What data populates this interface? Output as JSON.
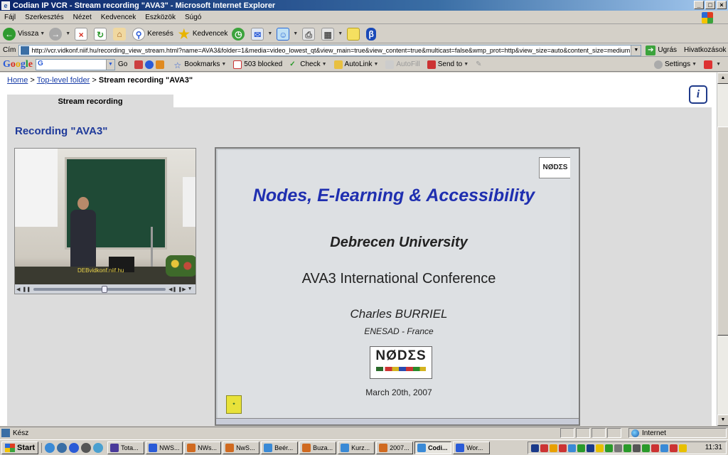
{
  "window": {
    "title": "Codian IP VCR - Stream recording \"AVA3\" - Microsoft Internet Explorer",
    "buttons": [
      "_",
      "□",
      "×"
    ]
  },
  "menu": [
    "Fájl",
    "Szerkesztés",
    "Nézet",
    "Kedvencek",
    "Eszközök",
    "Súgó"
  ],
  "toolbar": {
    "back_label": "Vissza",
    "search_label": "Keresés",
    "favorites_label": "Kedvencek"
  },
  "address": {
    "label": "Cím",
    "url": "http://vcr.vidkonf.niif.hu/recording_view_stream.html?name=AVA3&folder=1&media=video_lowest_qt&view_main=true&view_content=true&multicast=false&wmp_prot=http&view_size=auto&content_size=medium",
    "go_label": "Ugrás",
    "links_label": "Hivatkozások"
  },
  "google_bar": {
    "logo": [
      "G",
      "o",
      "o",
      "g",
      "l",
      "e"
    ],
    "search_value": "G",
    "go_label": "Go",
    "bookmarks_label": "Bookmarks",
    "blocked_label": "503 blocked",
    "check_label": "Check",
    "autolink_label": "AutoLink",
    "autofill_label": "AutoFill",
    "sendto_label": "Send to",
    "settings_label": "Settings"
  },
  "breadcrumb": {
    "home": "Home",
    "sep1": ">",
    "folder": "Top-level folder",
    "sep2": ">",
    "current": "Stream recording \"AVA3\""
  },
  "info_icon": "i",
  "tab_label": "Stream recording",
  "recording_title": "Recording \"AVA3\"",
  "video": {
    "caption": "DEBvidkonf.niif.hu"
  },
  "slide": {
    "logo_top": "NØDΣS",
    "title": "Nodes, E-learning & Accessibility",
    "university": "Debrecen University",
    "conference": "AVA3 International Conference",
    "speaker": "Charles BURRIEL",
    "org": "ENESAD - France",
    "logo_word": "NØDΣS",
    "date": "March 20th, 2007"
  },
  "status": {
    "text": "Kész",
    "zone": "Internet"
  },
  "taskbar": {
    "start": "Start",
    "tasks": [
      "Tota...",
      "NWS...",
      "NWs...",
      "NwS...",
      "Beér...",
      "Buza...",
      "Kurz...",
      "2007...",
      "Codi...",
      "Wor..."
    ],
    "clock": "11:31"
  },
  "colors": {
    "link": "#1a3ea8",
    "heading": "#1f3a9a",
    "slide_title": "#1f2fb0",
    "panel": "#dcdcdc"
  }
}
